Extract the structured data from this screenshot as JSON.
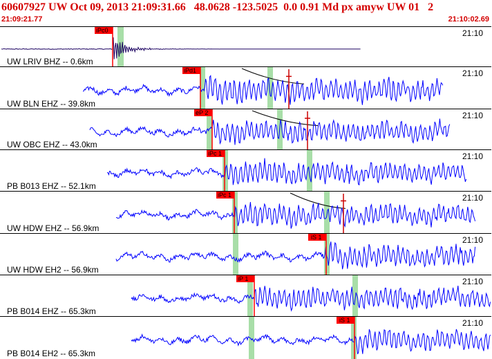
{
  "header": {
    "title": "60607927 UW Oct 09, 2013 21:09:31.66   48.0628 -123.5025  0.0 0.91 Md px amyw UW 01   2",
    "start_time": "21:09:21.77",
    "end_time": "21:10:02.69"
  },
  "colors": {
    "accent": "#d40000",
    "trace_blue": "#0000ff",
    "trace_first": "#1a0060",
    "pick_box": "#ff0000",
    "window_green": "#a8dea8"
  },
  "traces": [
    {
      "label": "UW LRIV BHZ -- 0.6km",
      "time": "21:10",
      "pick": "iPc0",
      "second_pick": ""
    },
    {
      "label": "UW BLN EHZ -- 39.8km",
      "time": "21:10",
      "pick": "iPd1",
      "second_pick": ""
    },
    {
      "label": "UW OBC EHZ -- 43.0km",
      "time": "21:10",
      "pick": "eP 2",
      "second_pick": ""
    },
    {
      "label": "PB B013 EHZ -- 52.1km",
      "time": "21:10",
      "pick": "iPc 1",
      "second_pick": ""
    },
    {
      "label": "UW HDW EHZ -- 56.9km",
      "time": "21:10",
      "pick": "iPc 1",
      "second_pick": ""
    },
    {
      "label": "UW HDW EH2 -- 56.9km",
      "time": "21:10",
      "pick": "",
      "second_pick": "iS 1"
    },
    {
      "label": "PB B014 EHZ -- 65.3km",
      "time": "21:10",
      "pick": "iP 1",
      "second_pick": ""
    },
    {
      "label": "PB B014 EH2 -- 65.3km",
      "time": "21:10",
      "pick": "",
      "second_pick": "iS 1"
    }
  ]
}
